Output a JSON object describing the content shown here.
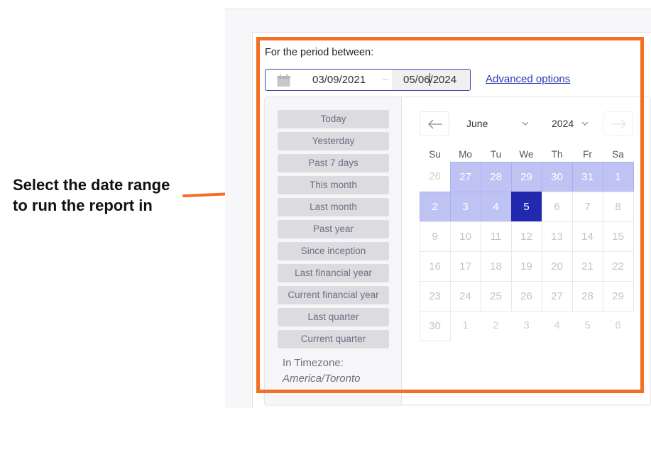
{
  "annotation": {
    "line1": "Select the date range",
    "line2": "to run the report in",
    "color": "#f36f21"
  },
  "form": {
    "period_label": "For the period between:",
    "date_start": "03/09/2021",
    "date_separator": "–",
    "date_end": "05/06/2024",
    "advanced_options_label": "Advanced options",
    "calendar_icon": "calendar-icon"
  },
  "sidebar": {
    "presets": [
      "Today",
      "Yesterday",
      "Past 7 days",
      "This month",
      "Last month",
      "Past year",
      "Since inception",
      "Last financial year",
      "Current financial year",
      "Last quarter",
      "Current quarter"
    ],
    "timezone_label": "In Timezone:",
    "timezone_value": "America/Toronto"
  },
  "calendar": {
    "prev_icon": "arrow-left-icon",
    "next_icon": "arrow-right-icon",
    "month": "June",
    "year": "2024",
    "weekdays": [
      "Su",
      "Mo",
      "Tu",
      "We",
      "Th",
      "Fr",
      "Sa"
    ],
    "colors": {
      "range": "#bfc3f3",
      "selected": "#2129ae"
    },
    "weeks": [
      [
        {
          "d": "26",
          "s": "outside"
        },
        {
          "d": "27",
          "s": "range"
        },
        {
          "d": "28",
          "s": "range"
        },
        {
          "d": "29",
          "s": "range"
        },
        {
          "d": "30",
          "s": "range"
        },
        {
          "d": "31",
          "s": "range"
        },
        {
          "d": "1",
          "s": "range"
        }
      ],
      [
        {
          "d": "2",
          "s": "range"
        },
        {
          "d": "3",
          "s": "range"
        },
        {
          "d": "4",
          "s": "range"
        },
        {
          "d": "5",
          "s": "selected"
        },
        {
          "d": "6",
          "s": "inmonth"
        },
        {
          "d": "7",
          "s": "inmonth"
        },
        {
          "d": "8",
          "s": "inmonth"
        }
      ],
      [
        {
          "d": "9",
          "s": "inmonth"
        },
        {
          "d": "10",
          "s": "inmonth"
        },
        {
          "d": "11",
          "s": "inmonth"
        },
        {
          "d": "12",
          "s": "inmonth"
        },
        {
          "d": "13",
          "s": "inmonth"
        },
        {
          "d": "14",
          "s": "inmonth"
        },
        {
          "d": "15",
          "s": "inmonth"
        }
      ],
      [
        {
          "d": "16",
          "s": "inmonth"
        },
        {
          "d": "17",
          "s": "inmonth"
        },
        {
          "d": "18",
          "s": "inmonth"
        },
        {
          "d": "19",
          "s": "inmonth"
        },
        {
          "d": "20",
          "s": "inmonth"
        },
        {
          "d": "21",
          "s": "inmonth"
        },
        {
          "d": "22",
          "s": "inmonth"
        }
      ],
      [
        {
          "d": "23",
          "s": "inmonth"
        },
        {
          "d": "24",
          "s": "inmonth"
        },
        {
          "d": "25",
          "s": "inmonth"
        },
        {
          "d": "26",
          "s": "inmonth"
        },
        {
          "d": "27",
          "s": "inmonth"
        },
        {
          "d": "28",
          "s": "inmonth"
        },
        {
          "d": "29",
          "s": "inmonth"
        }
      ],
      [
        {
          "d": "30",
          "s": "inmonth"
        },
        {
          "d": "1",
          "s": "outside"
        },
        {
          "d": "2",
          "s": "outside"
        },
        {
          "d": "3",
          "s": "outside"
        },
        {
          "d": "4",
          "s": "outside"
        },
        {
          "d": "5",
          "s": "outside"
        },
        {
          "d": "6",
          "s": "outside"
        }
      ]
    ]
  }
}
